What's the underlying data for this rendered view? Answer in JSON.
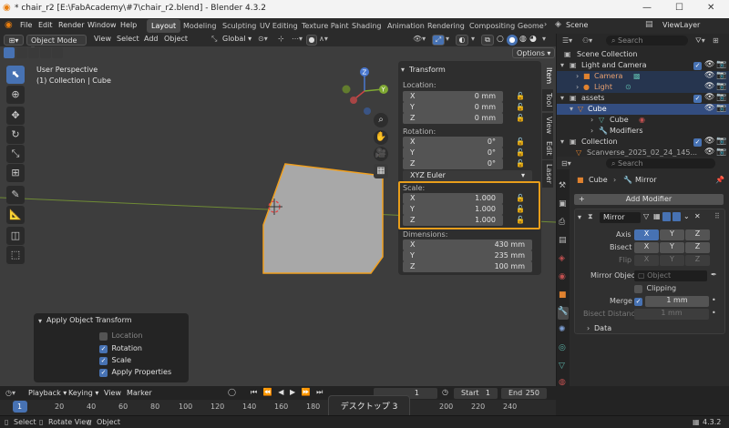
{
  "titlebar": {
    "title": "* chair_r2 [E:\\FabAcademy\\#7\\chair_r2.blend] - Blender 4.3.2"
  },
  "menubar": {
    "menus": [
      "File",
      "Edit",
      "Render",
      "Window",
      "Help"
    ],
    "workspaces": [
      "Layout",
      "Modeling",
      "Sculpting",
      "UV Editing",
      "Texture Paint",
      "Shading",
      "Animation",
      "Rendering",
      "Compositing",
      "Geome"
    ],
    "active_workspace": "Layout",
    "scene": "Scene",
    "view_layer": "ViewLayer"
  },
  "viewport_header": {
    "mode": "Object Mode",
    "menus": [
      "View",
      "Select",
      "Add",
      "Object"
    ],
    "orientation": "Global",
    "options": "Options"
  },
  "viewport": {
    "perspective": "User Perspective",
    "collection_info": "(1) Collection | Cube",
    "gizmo": {
      "x": "X",
      "y": "Y",
      "z": "Z"
    }
  },
  "npanel": {
    "title": "Transform",
    "location_label": "Location:",
    "location": [
      {
        "axis": "X",
        "value": "0 mm"
      },
      {
        "axis": "Y",
        "value": "0 mm"
      },
      {
        "axis": "Z",
        "value": "0 mm"
      }
    ],
    "rotation_label": "Rotation:",
    "rotation": [
      {
        "axis": "X",
        "value": "0°"
      },
      {
        "axis": "Y",
        "value": "0°"
      },
      {
        "axis": "Z",
        "value": "0°"
      }
    ],
    "rotation_mode": "XYZ Euler",
    "scale_label": "Scale:",
    "scale": [
      {
        "axis": "X",
        "value": "1.000"
      },
      {
        "axis": "Y",
        "value": "1.000"
      },
      {
        "axis": "Z",
        "value": "1.000"
      }
    ],
    "dimensions_label": "Dimensions:",
    "dimensions": [
      {
        "axis": "X",
        "value": "430 mm"
      },
      {
        "axis": "Y",
        "value": "235 mm"
      },
      {
        "axis": "Z",
        "value": "100 mm"
      }
    ],
    "tabs": [
      "Item",
      "Tool",
      "View",
      "Edit",
      "Laser"
    ],
    "highlight_color": "#e89e1b"
  },
  "operator_panel": {
    "title": "Apply Object Transform",
    "options": [
      {
        "label": "Location",
        "checked": false
      },
      {
        "label": "Rotation",
        "checked": true
      },
      {
        "label": "Scale",
        "checked": true
      },
      {
        "label": "Apply Properties",
        "checked": true
      }
    ]
  },
  "outliner": {
    "search_placeholder": "Search",
    "rows": [
      {
        "label": "Scene Collection"
      },
      {
        "label": "Light and Camera"
      },
      {
        "label": "Camera"
      },
      {
        "label": "Light"
      },
      {
        "label": "assets"
      },
      {
        "label": "Cube"
      },
      {
        "label": "Cube"
      },
      {
        "label": "Modifiers"
      },
      {
        "label": "Collection"
      },
      {
        "label": "Scanverse_2025_02_24_145..."
      }
    ]
  },
  "properties": {
    "search_placeholder": "Search",
    "breadcrumb_object": "Cube",
    "breadcrumb_modifier": "Mirror",
    "add_modifier": "Add Modifier",
    "modifier_name": "Mirror",
    "axis_label": "Axis",
    "bisect_label": "Bisect",
    "flip_label": "Flip",
    "xyz": [
      "X",
      "Y",
      "Z"
    ],
    "mirror_object_label": "Mirror Object",
    "object_placeholder": "Object",
    "clipping_label": "Clipping",
    "merge_label": "Merge",
    "merge_value": "1 mm",
    "bisect_distance_label": "Bisect Distance",
    "bisect_distance_value": "1 mm",
    "data_label": "Data"
  },
  "timeline": {
    "menus": [
      "Playback",
      "Keying",
      "View",
      "Marker"
    ],
    "current_frame": "1",
    "start_label": "Start",
    "start": "1",
    "end_label": "End",
    "end": "250",
    "ruler": [
      "1",
      "20",
      "40",
      "60",
      "80",
      "100",
      "120",
      "140",
      "160",
      "180",
      "200",
      "220",
      "240"
    ]
  },
  "toast": "デスクトップ 3",
  "statusbar": {
    "select": "Select",
    "rotate": "Rotate View",
    "object": "Object",
    "version": "4.3.2"
  }
}
